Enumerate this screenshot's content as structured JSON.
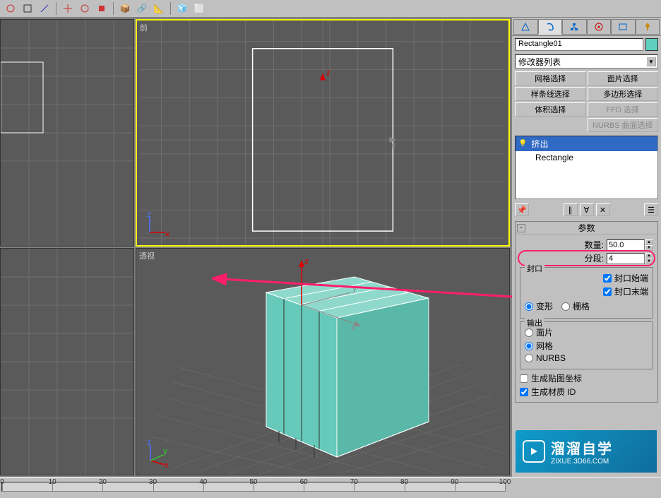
{
  "toolbar": {
    "icons": [
      "select",
      "link",
      "move",
      "rotate",
      "scale",
      "mirror",
      "align",
      "layers",
      "curve",
      "schematic",
      "material",
      "render",
      "teapot",
      "settings"
    ]
  },
  "viewports": {
    "top_left_label": "",
    "front_label": "前",
    "persp_label": "透视",
    "rect_axis_x": "x",
    "rect_axis_y": "y",
    "rect_axis_z": "z"
  },
  "panel": {
    "object_name": "Rectangle01",
    "modifier_list_label": "修改器列表",
    "buttons": {
      "mesh_select": "网格选择",
      "patch_select": "面片选择",
      "spline_select": "样条线选择",
      "poly_select": "多边形选择",
      "vol_select": "体积选择",
      "ffd_select": "FFD 选择",
      "nurbs_surf": "NURBS 曲面选择"
    },
    "stack": {
      "extrude": "挤出",
      "rectangle": "Rectangle"
    },
    "rollout_params_title": "参数",
    "params": {
      "amount_label": "数量:",
      "amount_value": "50.0",
      "segments_label": "分段:",
      "segments_value": "4"
    },
    "cap_group": "封口",
    "cap_start": "封口始端",
    "cap_end": "封口末端",
    "morph": "变形",
    "grid": "栅格",
    "output_group": "输出",
    "out_patch": "面片",
    "out_mesh": "网格",
    "out_nurbs": "NURBS",
    "gen_map": "生成贴图坐标",
    "gen_mat_id": "生成材质 ID"
  },
  "ruler": {
    "marks": [
      0,
      10,
      20,
      30,
      40,
      50,
      60,
      70,
      80,
      90,
      100
    ]
  },
  "watermark": {
    "title": "溜溜自学",
    "url": "ZIXUE.3D66.COM"
  }
}
